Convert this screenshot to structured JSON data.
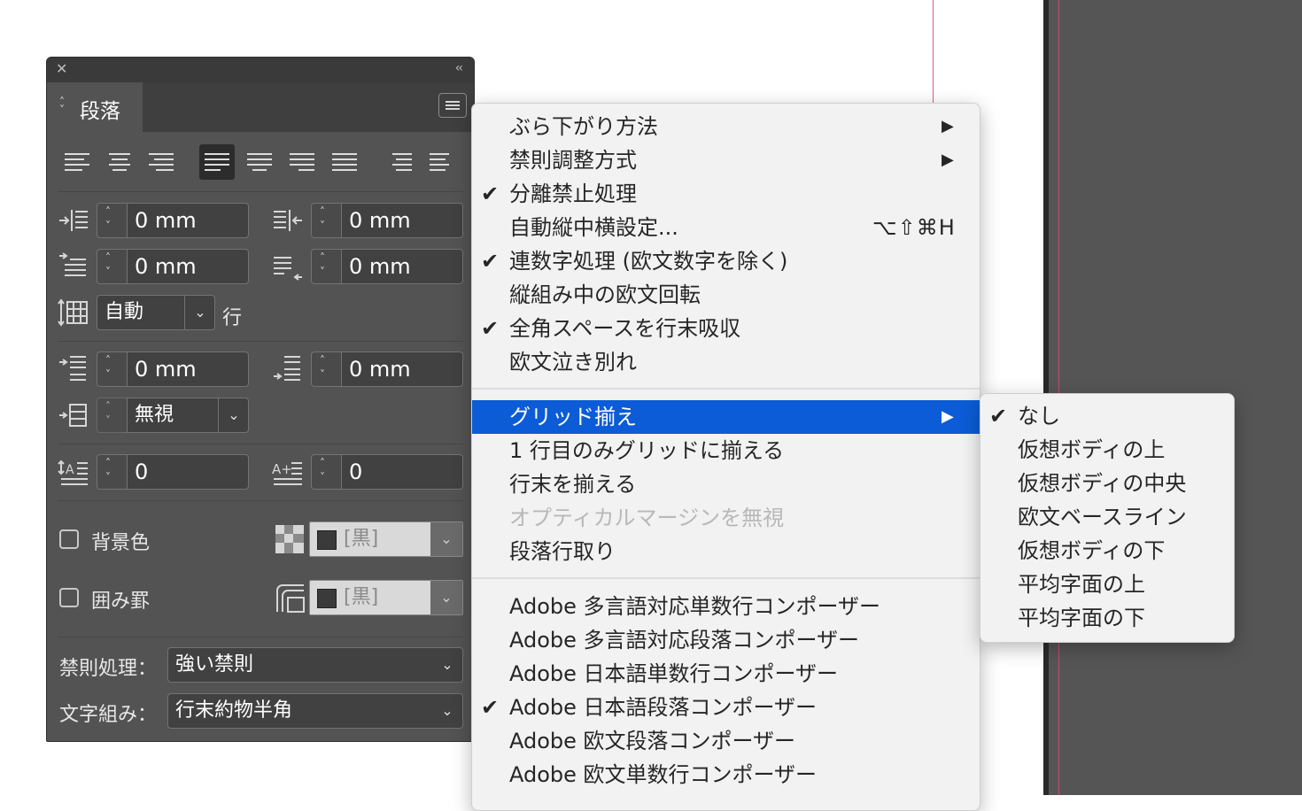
{
  "panel": {
    "tab_label": "段落",
    "indent_left": "0 mm",
    "indent_right": "0 mm",
    "first_line_indent": "0 mm",
    "last_line_indent": "0 mm",
    "line_count_value": "自動",
    "line_count_unit": "行",
    "space_before": "0 mm",
    "space_after": "0 mm",
    "grid_option": "無視",
    "drop_cap_lines": "0",
    "drop_cap_chars": "0",
    "bg_color_label": "背景色",
    "bg_color_swatch": "[黒]",
    "border_label": "囲み罫",
    "border_swatch": "[黒]",
    "kinsoku_label": "禁則処理：",
    "kinsoku_value": "強い禁則",
    "mojikumi_label": "文字組み：",
    "mojikumi_value": "行末約物半角"
  },
  "menu": {
    "items": [
      {
        "label": "ぶら下がり方法",
        "check": "",
        "arrow": "▶"
      },
      {
        "label": "禁則調整方式",
        "check": "",
        "arrow": "▶"
      },
      {
        "label": "分離禁止処理",
        "check": "✔",
        "arrow": ""
      },
      {
        "label": "自動縦中横設定...",
        "check": "",
        "shortcut": "⌥⇧⌘H"
      },
      {
        "label": "連数字処理 (欧文数字を除く)",
        "check": "✔"
      },
      {
        "label": "縦組み中の欧文回転",
        "check": ""
      },
      {
        "label": "全角スペースを行末吸収",
        "check": "✔"
      },
      {
        "label": "欧文泣き別れ",
        "check": ""
      },
      {
        "label": "グリッド揃え",
        "check": "",
        "arrow": "▶"
      },
      {
        "label": "1 行目のみグリッドに揃える",
        "check": ""
      },
      {
        "label": "行末を揃える",
        "check": ""
      },
      {
        "label": "オプティカルマージンを無視",
        "check": ""
      },
      {
        "label": "段落行取り",
        "check": ""
      },
      {
        "label": "Adobe 多言語対応単数行コンポーザー",
        "check": ""
      },
      {
        "label": "Adobe 多言語対応段落コンポーザー",
        "check": ""
      },
      {
        "label": "Adobe 日本語単数行コンポーザー",
        "check": ""
      },
      {
        "label": "Adobe 日本語段落コンポーザー",
        "check": "✔"
      },
      {
        "label": "Adobe 欧文段落コンポーザー",
        "check": ""
      },
      {
        "label": "Adobe 欧文単数行コンポーザー",
        "check": ""
      }
    ]
  },
  "submenu": {
    "items": [
      {
        "label": "なし",
        "check": "✔"
      },
      {
        "label": "仮想ボディの上",
        "check": ""
      },
      {
        "label": "仮想ボディの中央",
        "check": ""
      },
      {
        "label": "欧文ベースライン",
        "check": ""
      },
      {
        "label": "仮想ボディの下",
        "check": ""
      },
      {
        "label": "平均字面の上",
        "check": ""
      },
      {
        "label": "平均字面の下",
        "check": ""
      }
    ]
  },
  "colors": {
    "highlight": "#0b5cd6",
    "panel_bg": "#535353",
    "pasteboard": "#555555",
    "guide": "#e0559a"
  }
}
